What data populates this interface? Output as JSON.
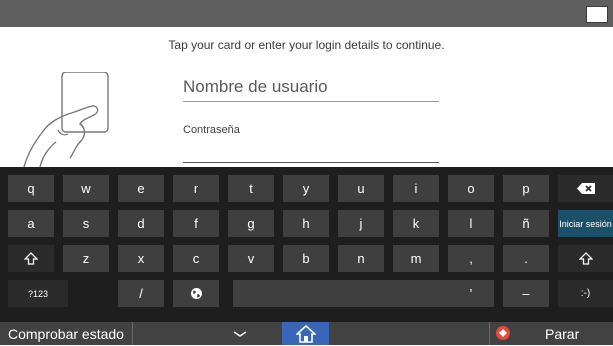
{
  "header": {
    "sleep_icon": "moon-icon"
  },
  "login": {
    "prompt": "Tap your card or enter your login details to continue.",
    "username_placeholder": "Nombre de usuario",
    "password_label": "Contraseña"
  },
  "keyboard": {
    "rows": [
      [
        "q",
        "w",
        "e",
        "r",
        "t",
        "y",
        "u",
        "i",
        "o",
        "p",
        "backspace"
      ],
      [
        "a",
        "s",
        "d",
        "f",
        "g",
        "h",
        "j",
        "k",
        "l",
        "ñ",
        "Iniciar sesión"
      ],
      [
        "shift",
        "z",
        "x",
        "c",
        "v",
        "b",
        "n",
        "m",
        ",",
        ".",
        "shift"
      ],
      [
        "?123",
        "",
        "/",
        "globe",
        "space",
        "'",
        "-",
        ":-)"
      ]
    ],
    "key_r1": [
      "q",
      "w",
      "e",
      "r",
      "t",
      "y",
      "u",
      "i",
      "o",
      "p"
    ],
    "key_r2": [
      "a",
      "s",
      "d",
      "f",
      "g",
      "h",
      "j",
      "k",
      "l",
      "ñ"
    ],
    "key_r3": [
      "z",
      "x",
      "c",
      "v",
      "b",
      "n",
      "m",
      ",",
      "."
    ],
    "symbols_key": "?123",
    "slash_key": "/",
    "apostrophe_key": "'",
    "dash_key": "–",
    "smiley_key": ":-)",
    "login_key": "Iniciar sesión"
  },
  "statusbar": {
    "check_status": "Comprobar estado",
    "stop": "Parar"
  },
  "colors": {
    "accent": "#1a5068",
    "home": "#3a66b8",
    "stop": "#e24b3b"
  }
}
